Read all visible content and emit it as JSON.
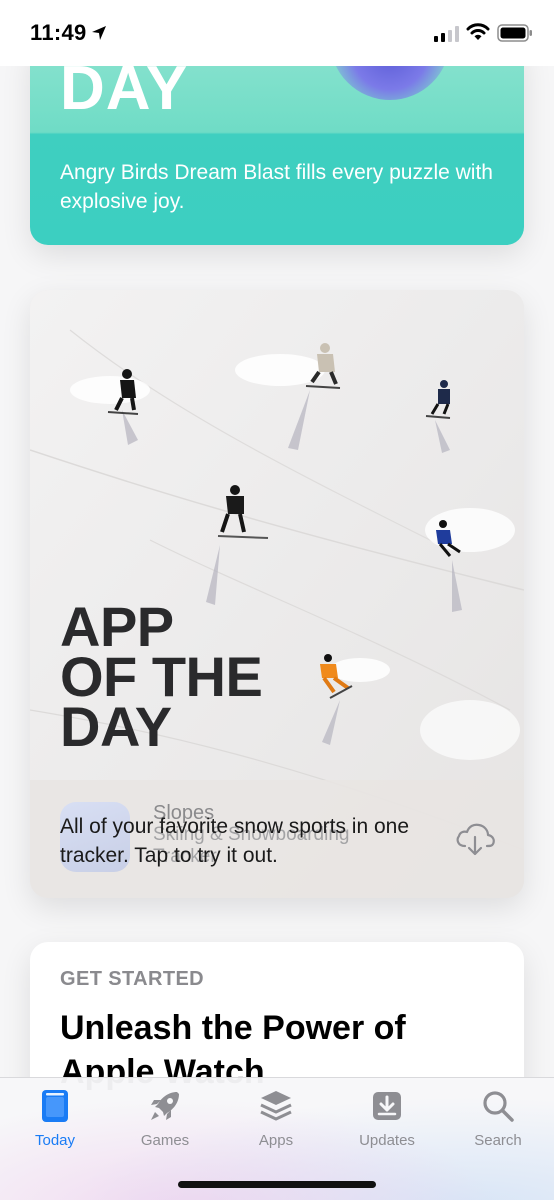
{
  "status_bar": {
    "time": "11:49",
    "icons": [
      "location-arrow",
      "cellular-signal",
      "wifi",
      "battery"
    ]
  },
  "feed": {
    "card_1": {
      "heading": "DAY",
      "description": "Angry Birds Dream Blast fills every puzzle with explosive joy."
    },
    "card_2": {
      "heading_lines": [
        "APP",
        "OF THE",
        "DAY"
      ],
      "app_name": "Slopes",
      "app_subtitle": "Skiing & Snowboarding Tracker",
      "description": "All of your favorite snow sports in one tracker. Tap to try it out.",
      "action_icon": "cloud-download"
    },
    "card_3": {
      "eyebrow": "GET STARTED",
      "title": "Unleash the Power of Apple Watch"
    }
  },
  "tab_bar": {
    "active": "Today",
    "accent_color": "#1a7cf5",
    "inactive_color": "#8e8e93",
    "tabs": [
      {
        "label": "Today",
        "icon": "today-icon"
      },
      {
        "label": "Games",
        "icon": "rocket-icon"
      },
      {
        "label": "Apps",
        "icon": "layers-icon"
      },
      {
        "label": "Updates",
        "icon": "download-tray-icon"
      },
      {
        "label": "Search",
        "icon": "magnifier-icon"
      }
    ]
  }
}
